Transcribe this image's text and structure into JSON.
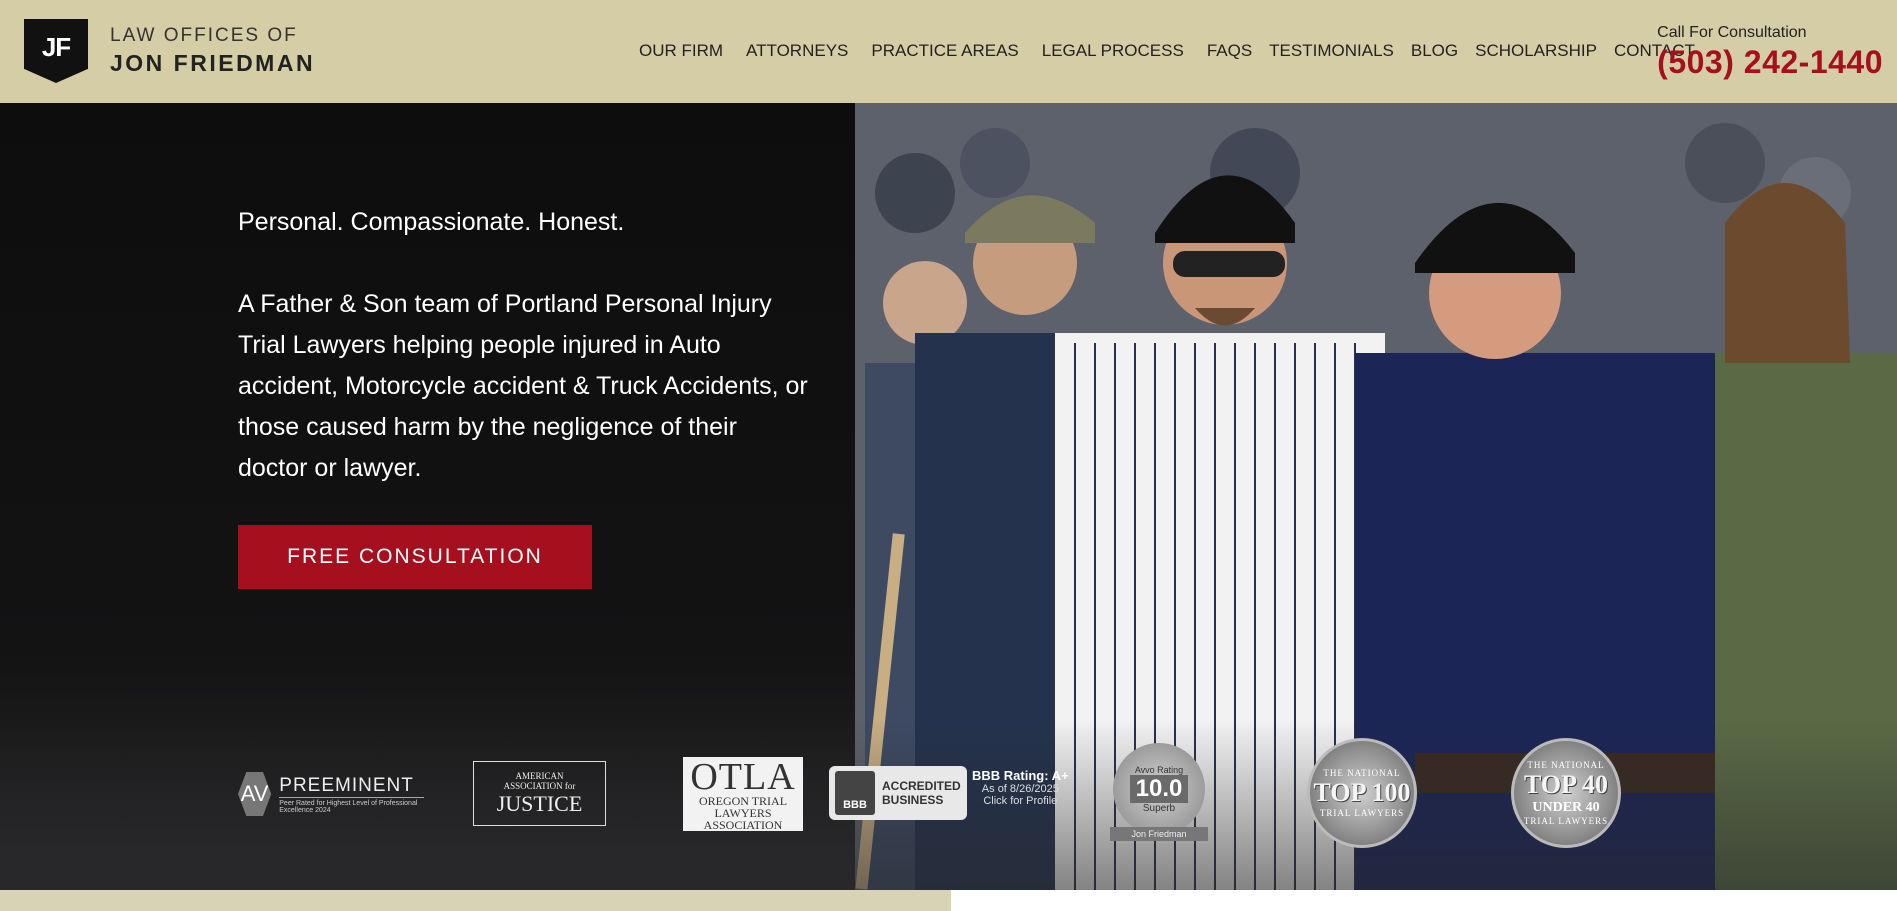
{
  "header": {
    "logo_initials": "JF",
    "logo_line1": "LAW OFFICES OF",
    "logo_line2": "JON FRIEDMAN",
    "nav": [
      {
        "label": "OUR FIRM"
      },
      {
        "label": "ATTORNEYS"
      },
      {
        "label": "PRACTICE AREAS"
      },
      {
        "label": "LEGAL PROCESS"
      },
      {
        "label": "FAQS"
      },
      {
        "label": "TESTIMONIALS"
      },
      {
        "label": "BLOG"
      },
      {
        "label": "SCHOLARSHIP"
      },
      {
        "label": "CONTACT"
      }
    ],
    "consult_label": "Call For Consultation",
    "phone": "(503) 242-1440"
  },
  "hero": {
    "tagline": "Personal. Compassionate. Honest.",
    "body": "A Father & Son team of Portland Personal Injury Trial Lawyers helping people injured in Auto accident, Motorcycle accident & Truck Accidents, or those caused harm by the negligence of their doctor or lawyer.",
    "cta_label": "FREE CONSULTATION"
  },
  "badges": {
    "av": {
      "mark": "AV",
      "title": "PREEMINENT",
      "sub": "Peer Rated for Highest Level of Professional Excellence",
      "year": "2024"
    },
    "aaj": {
      "line1": "AMERICAN",
      "line2": "ASSOCIATION for",
      "line3": "JUSTICE"
    },
    "otla": {
      "big": "OTLA",
      "line1": "OREGON TRIAL",
      "line2": "LAWYERS",
      "line3": "ASSOCIATION"
    },
    "bbb": {
      "mark": "BBB",
      "line1": "ACCREDITED",
      "line2": "BUSINESS",
      "rating": "BBB Rating: A+",
      "asof": "As of 8/26/2025",
      "click": "Click for Profile"
    },
    "avvo": {
      "top": "Avvo Rating",
      "score": "10.0",
      "word": "Superb",
      "name": "Jon Friedman"
    },
    "top100": {
      "top": "THE NATIONAL",
      "big": "TOP 100",
      "bot": "TRIAL LAWYERS"
    },
    "top40": {
      "top": "THE NATIONAL",
      "big": "TOP 40",
      "mid": "UNDER 40",
      "bot": "TRIAL LAWYERS"
    }
  },
  "colors": {
    "header_bg": "#d5cda6",
    "accent_red": "#a6101e",
    "hero_bg": "#111111"
  }
}
